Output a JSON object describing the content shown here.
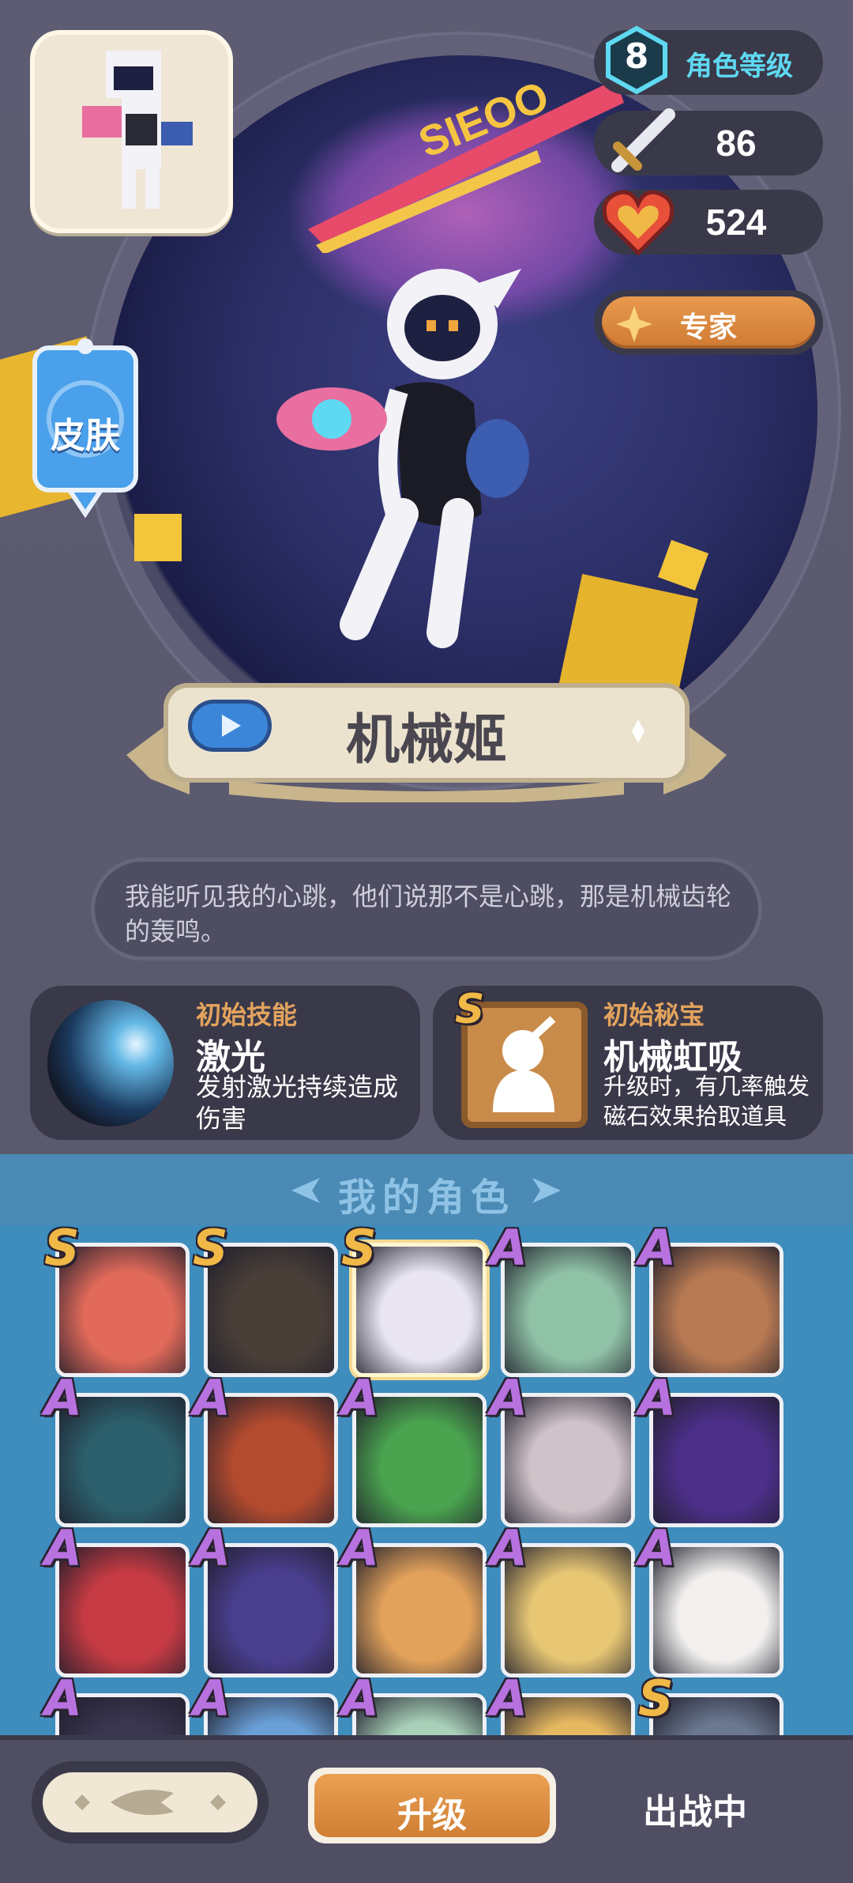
{
  "hero": {
    "name": "机械姬",
    "quote": "我能听见我的心跳，他们说那不是心跳，那是机械齿轮的轰鸣。",
    "skin_label": "皮肤",
    "banner_overlay_text": "SIEOO"
  },
  "stats": {
    "level": "8",
    "level_label": "角色等级",
    "attack": "86",
    "health": "524",
    "rank_label": "专家"
  },
  "skill_card": {
    "title": "初始技能",
    "name": "激光",
    "desc": "发射激光持续造成伤害"
  },
  "treasure_card": {
    "rank": "S",
    "title": "初始秘宝",
    "name": "机械虹吸",
    "desc": "升级时，有几率触发磁石效果拾取道具"
  },
  "roster": {
    "title": "我的角色",
    "slots": [
      {
        "rank": "S",
        "color": "#e26a5a",
        "selected": false
      },
      {
        "rank": "S",
        "color": "#4a3f38",
        "selected": false
      },
      {
        "rank": "S",
        "color": "#e9e6f2",
        "selected": true
      },
      {
        "rank": "A",
        "color": "#8fc2a6",
        "selected": false
      },
      {
        "rank": "A",
        "color": "#b87a53",
        "selected": false
      },
      {
        "rank": "A",
        "color": "#2c5f6c",
        "selected": false
      },
      {
        "rank": "A",
        "color": "#b34b2f",
        "selected": false
      },
      {
        "rank": "A",
        "color": "#4aa34f",
        "selected": false
      },
      {
        "rank": "A",
        "color": "#cfc2c8",
        "selected": false
      },
      {
        "rank": "A",
        "color": "#4d2f8a",
        "selected": false
      },
      {
        "rank": "A",
        "color": "#c63b43",
        "selected": false
      },
      {
        "rank": "A",
        "color": "#4a3f8f",
        "selected": false
      },
      {
        "rank": "A",
        "color": "#e2a25b",
        "selected": false
      },
      {
        "rank": "A",
        "color": "#e7c674",
        "selected": false
      },
      {
        "rank": "A",
        "color": "#f2f0ee",
        "selected": false
      },
      {
        "rank": "A",
        "color": "#3a3550",
        "selected": false
      },
      {
        "rank": "A",
        "color": "#6aa0d8",
        "selected": false
      },
      {
        "rank": "A",
        "color": "#a8d0b8",
        "selected": false
      },
      {
        "rank": "A",
        "color": "#e6b860",
        "selected": false
      },
      {
        "rank": "S",
        "color": "#6a7890",
        "selected": false
      }
    ]
  },
  "bottom": {
    "upgrade_label": "升级",
    "status_label": "出战中"
  },
  "colors": {
    "accent_orange": "#e0913f",
    "level_cyan": "#5fd9f2",
    "rank_s": "#f0b847",
    "rank_a": "#b872e0"
  }
}
